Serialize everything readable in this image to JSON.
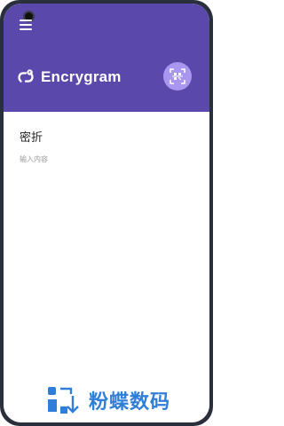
{
  "header": {
    "title": "Encrygram",
    "background_color": "#5a48ab",
    "scan_button_color": "#a896f0",
    "menu_icon": "hamburger-menu-icon",
    "brand_icon": "link-chain-icon",
    "scan_icon": "qr-scan-icon"
  },
  "main": {
    "field_label": "密折",
    "field_placeholder": "输入内容"
  },
  "watermark": {
    "text": "粉蝶数码",
    "color": "#2f7ed8"
  }
}
